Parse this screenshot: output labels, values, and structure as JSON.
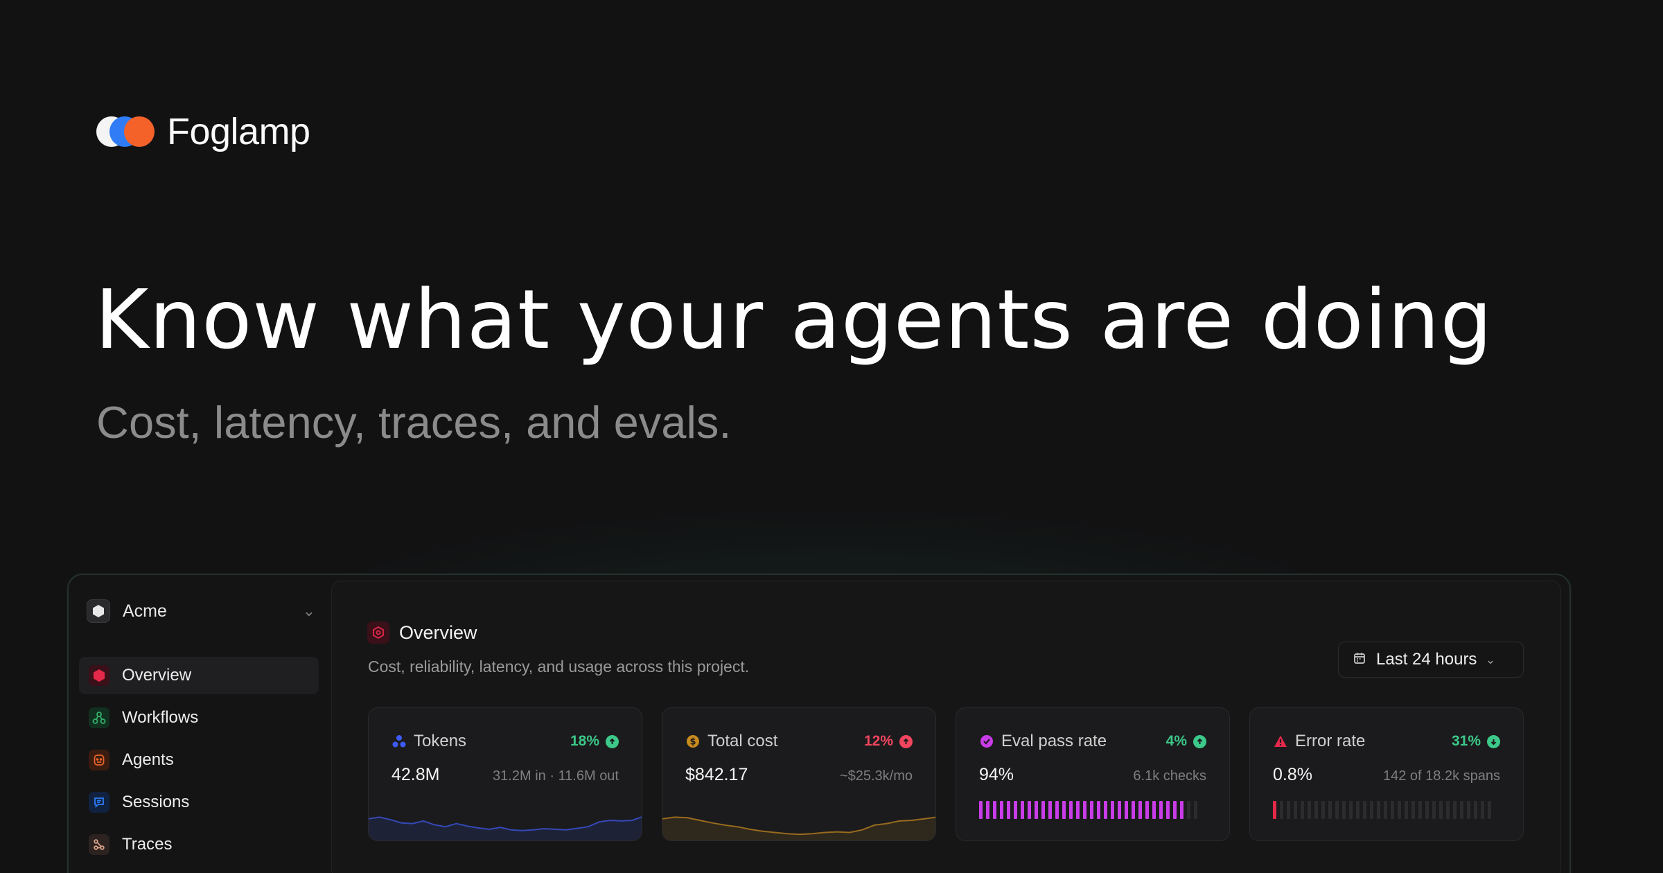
{
  "brand": {
    "name": "Foglamp"
  },
  "hero": {
    "headline": "Know what your agents are doing",
    "subline": "Cost, latency, traces, and evals."
  },
  "sidebar": {
    "org": {
      "name": "Acme",
      "icon": "hexagon-icon"
    },
    "items": [
      {
        "label": "Overview",
        "icon": "overview-icon",
        "color": "#e5294a",
        "active": true
      },
      {
        "label": "Workflows",
        "icon": "workflow-icon",
        "color": "#35b06a",
        "active": false
      },
      {
        "label": "Agents",
        "icon": "agent-icon",
        "color": "#e8632c",
        "active": false
      },
      {
        "label": "Sessions",
        "icon": "sessions-icon",
        "color": "#2f7cf6",
        "active": false
      },
      {
        "label": "Traces",
        "icon": "traces-icon",
        "color": "#d9a28a",
        "active": false
      }
    ]
  },
  "page": {
    "title": "Overview",
    "description": "Cost, reliability, latency, and usage across this project.",
    "range_label": "Last 24 hours"
  },
  "kpis": [
    {
      "label": "Tokens",
      "delta": "18%",
      "direction": "up",
      "delta_color": "#3cc98a",
      "value": "42.8M",
      "meta": "31.2M in · 11.6M out",
      "accent": "#3d5bf5",
      "spark": [
        0.55,
        0.6,
        0.52,
        0.42,
        0.4,
        0.48,
        0.36,
        0.3,
        0.4,
        0.32,
        0.26,
        0.22,
        0.28,
        0.2,
        0.18,
        0.2,
        0.24,
        0.22,
        0.2,
        0.25,
        0.3,
        0.45,
        0.5,
        0.48,
        0.5,
        0.62
      ]
    },
    {
      "label": "Total cost",
      "delta": "12%",
      "direction": "up",
      "delta_color": "#f0455e",
      "value": "$842.17",
      "meta": "~$25.3k/mo",
      "accent": "#c98a1e",
      "spark": [
        0.55,
        0.6,
        0.58,
        0.5,
        0.42,
        0.35,
        0.3,
        0.22,
        0.16,
        0.12,
        0.08,
        0.06,
        0.08,
        0.12,
        0.14,
        0.12,
        0.2,
        0.35,
        0.4,
        0.48,
        0.5,
        0.55,
        0.6
      ]
    },
    {
      "label": "Eval pass rate",
      "delta": "4%",
      "direction": "up",
      "delta_color": "#3cc98a",
      "value": "94%",
      "meta": "6.1k checks",
      "accent": "#c93de8",
      "fill_fraction": 0.94,
      "bar_count": 32
    },
    {
      "label": "Error rate",
      "delta": "31%",
      "direction": "down",
      "delta_color": "#3cc98a",
      "value": "0.8%",
      "meta": "142 of 18.2k spans",
      "accent": "#e5294a",
      "fill_fraction": 0.008,
      "bar_count": 32
    }
  ]
}
